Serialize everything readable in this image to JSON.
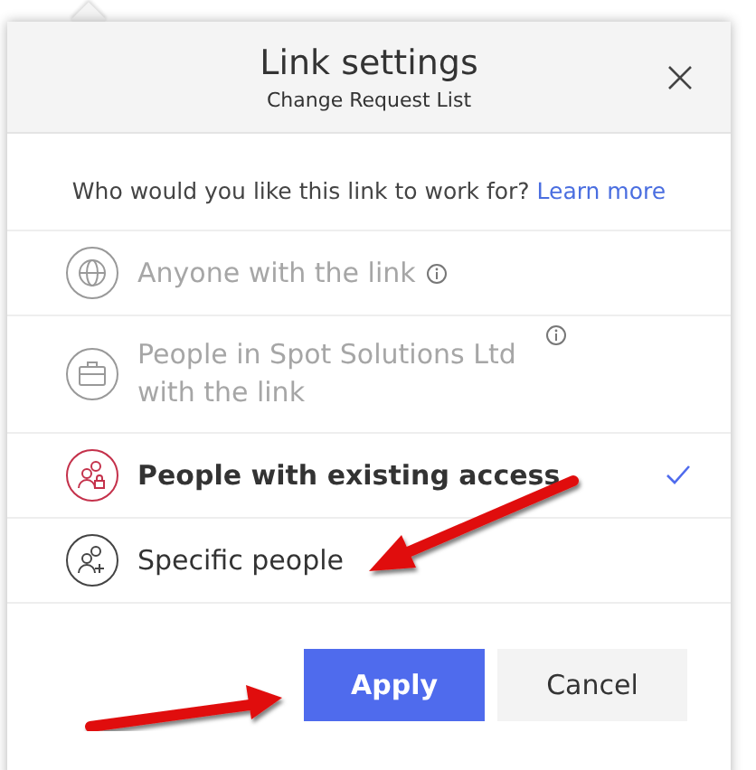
{
  "dialog": {
    "title": "Link settings",
    "subtitle": "Change Request List",
    "question": "Who would you like this link to work for?",
    "learn_more": "Learn more",
    "options": [
      {
        "label": "Anyone with the link",
        "kind": "globe",
        "disabled": true,
        "info": true,
        "selected": false
      },
      {
        "label": "People in Spot Solutions Ltd with the link",
        "kind": "briefcase",
        "disabled": true,
        "info": true,
        "selected": false
      },
      {
        "label": "People with existing access",
        "kind": "people-lock",
        "disabled": false,
        "info": false,
        "selected": true
      },
      {
        "label": "Specific people",
        "kind": "people-add",
        "disabled": false,
        "info": false,
        "selected": false
      }
    ],
    "buttons": [
      {
        "label": "Apply",
        "kind": "primary"
      },
      {
        "label": "Cancel",
        "kind": "secondary"
      }
    ]
  }
}
